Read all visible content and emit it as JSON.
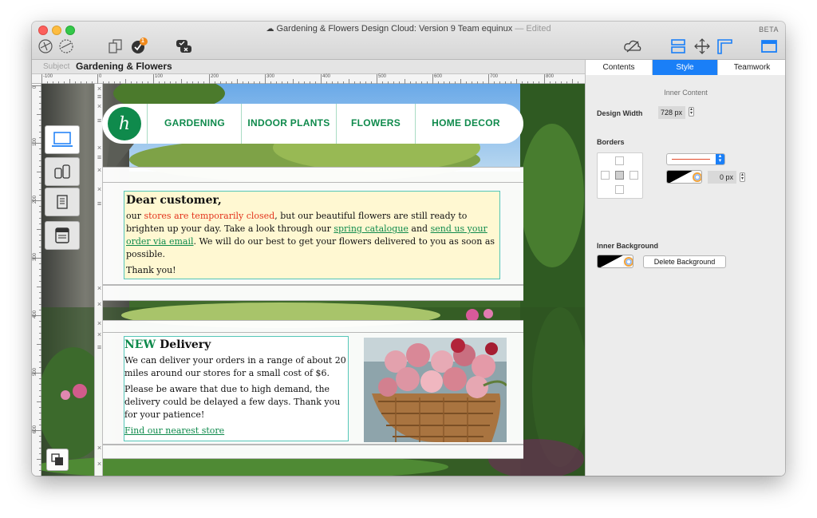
{
  "window": {
    "title": "Gardening & Flowers Design Cloud: Version 9 Team equinux",
    "title_status": "— Edited",
    "beta": "BETA",
    "badge_count": "1"
  },
  "subject": {
    "label": "Subject",
    "value": "Gardening & Flowers"
  },
  "ruler": {
    "h_ticks": [
      "-100",
      "0",
      "100",
      "200",
      "300",
      "400",
      "500",
      "600",
      "700",
      "800"
    ],
    "v_ticks": [
      "0",
      "100",
      "200",
      "300",
      "400",
      "500",
      "600"
    ]
  },
  "site": {
    "logo_letter": "h",
    "nav": [
      "GARDENING",
      "INDOOR PLANTS",
      "FLOWERS",
      "HOME DECOR"
    ],
    "notice": {
      "heading": "Dear customer,",
      "p1_a": "our ",
      "p1_red": "stores are temporarily closed",
      "p1_b": ", but our beautiful flowers are still ready to brighten up your day. Take a look through our ",
      "link1": "spring catalogue",
      "p1_c": " and ",
      "link2": "send us your order via email",
      "p1_d": ". We will do our best to get your flowers delivered to you as soon as possible.",
      "p2": "Thank you!"
    },
    "delivery": {
      "heading_new": "NEW",
      "heading_rest": " Delivery",
      "p1": "We can deliver your orders in a range of about 20 miles around our stores for a small cost of $6.",
      "p2": "Please be aware that due to high demand, the delivery could be delayed a few days. Thank you for your patience!",
      "link": "Find our nearest store"
    }
  },
  "inspector": {
    "tabs": [
      "Contents",
      "Style",
      "Teamwork"
    ],
    "active_tab": "Style",
    "section_title": "Inner Content",
    "design_width_label": "Design Width",
    "design_width_value": "728 px",
    "borders_label": "Borders",
    "border_width_value": "0 px",
    "inner_background_label": "Inner Background",
    "delete_background_label": "Delete Background"
  },
  "colors": {
    "accent": "#1a7ff7",
    "brand_green": "#0f8a4c",
    "notice_red": "#e3341c",
    "notice_bg": "#fff8d2"
  }
}
